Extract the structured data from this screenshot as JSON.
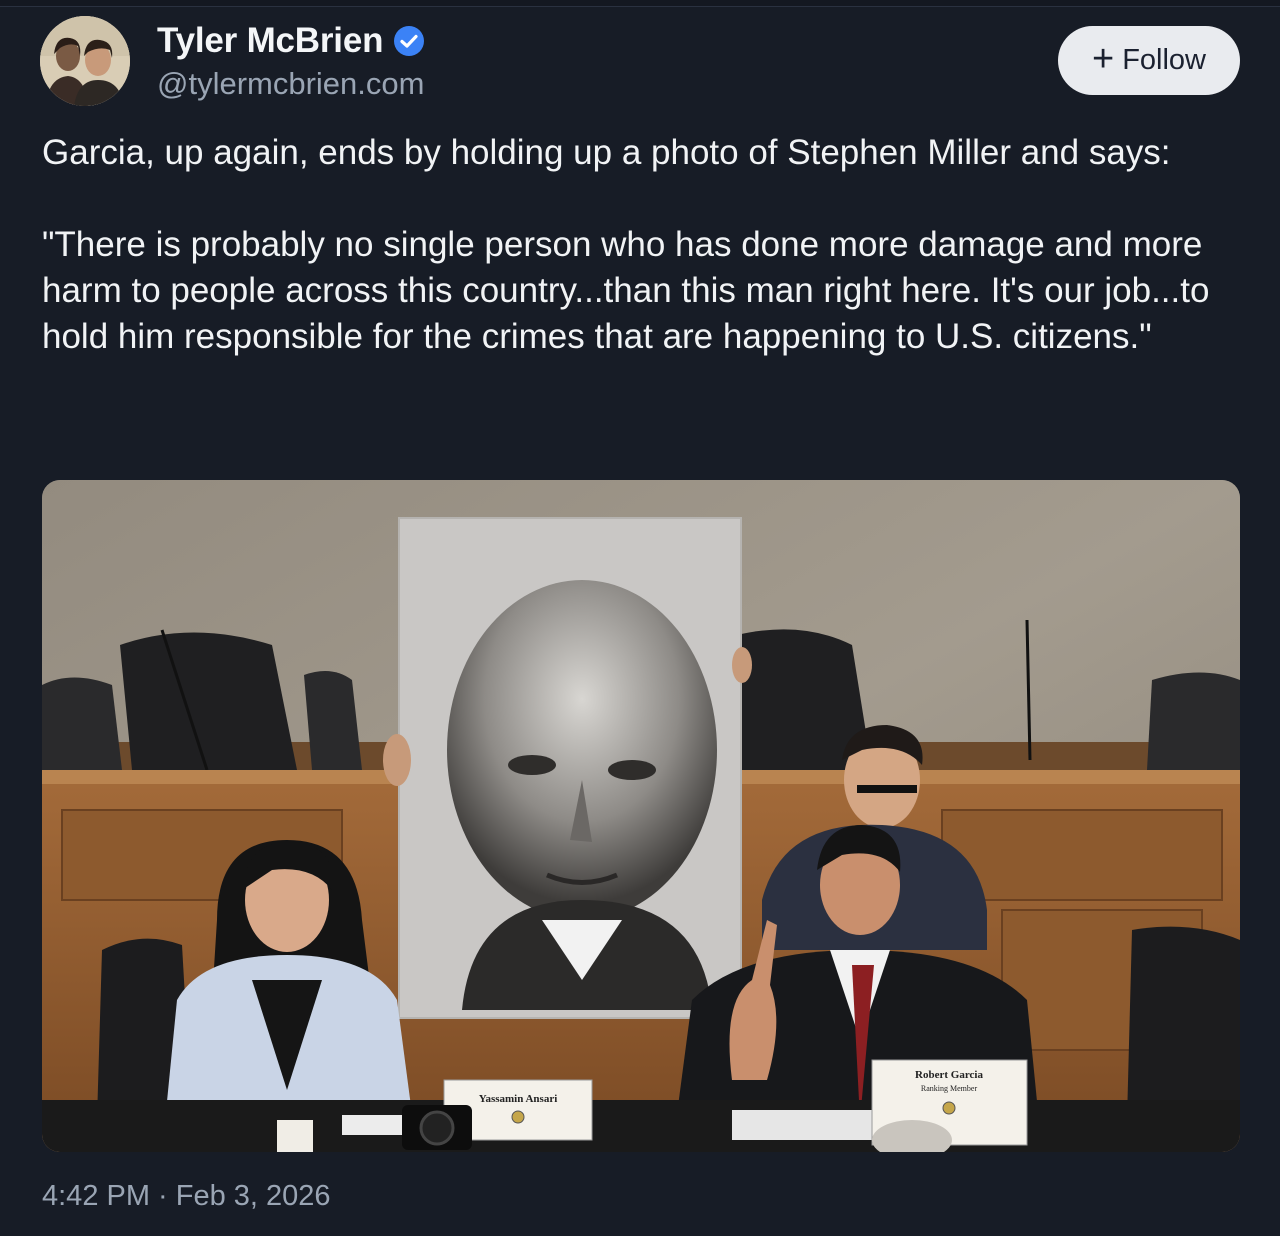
{
  "author": {
    "display_name": "Tyler McBrien",
    "handle": "@tylermcbrien.com",
    "verified": true,
    "avatar_icon": "avatar-photo"
  },
  "follow_button": {
    "icon": "+",
    "label": "Follow"
  },
  "post": {
    "paragraphs": [
      "Garcia, up again, ends by holding up a photo of Stephen Miller and says:",
      "\"There is probably no single person who has done more damage and more harm to people across this country...than this man right here. It's our job...to hold him responsible for the crimes that are happening to U.S. citizens.\""
    ]
  },
  "media": {
    "nameplate_left": "Yassamin Ansari",
    "nameplate_right_name": "Robert Garcia",
    "nameplate_right_title": "Ranking Member"
  },
  "meta": {
    "timestamp": "4:42 PM · Feb 3, 2026"
  },
  "colors": {
    "background": "#171c26",
    "text": "#f1f3f5",
    "muted": "#9aa5b4",
    "verified": "#3b82f6",
    "follow_bg": "#e9ebef"
  }
}
